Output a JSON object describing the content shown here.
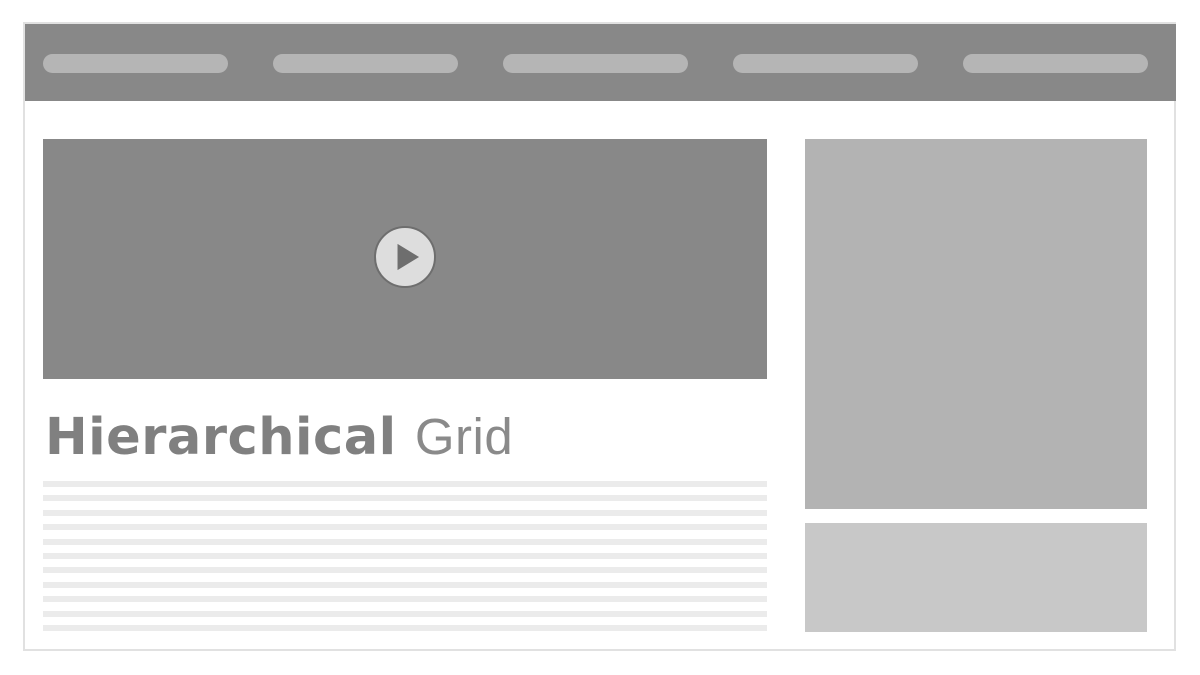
{
  "title": {
    "bold_text": "Hierarchical",
    "light_text": "Grid"
  },
  "nav": {
    "items": [
      "",
      "",
      "",
      "",
      ""
    ]
  },
  "colors": {
    "header": "#888888",
    "nav_pill": "#b5b5b5",
    "video": "#888888",
    "play_button": "#dddddd",
    "sidebar_large": "#b3b3b3",
    "sidebar_small": "#c8c8c8",
    "text_lines": "#ebebeb"
  },
  "icons": {
    "play": "play-icon"
  }
}
